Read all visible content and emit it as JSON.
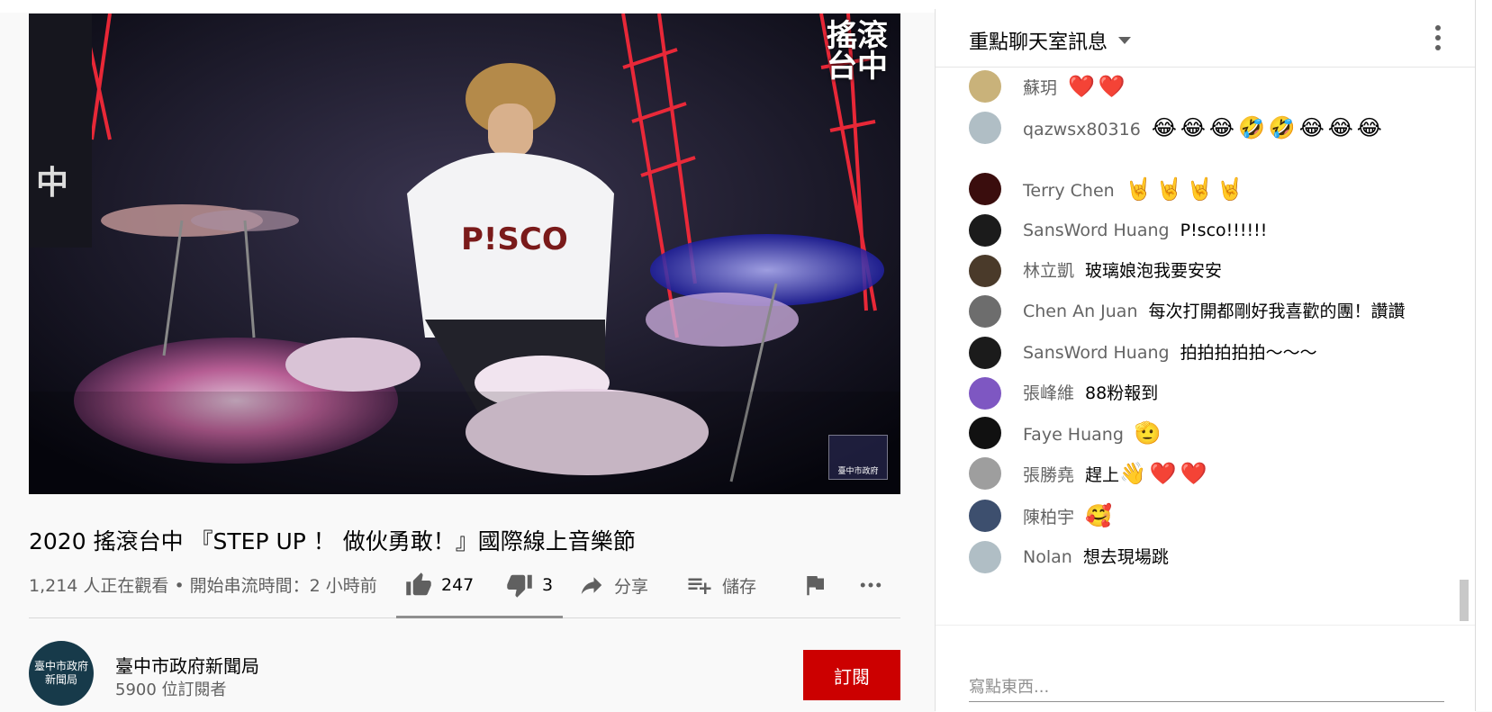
{
  "video": {
    "badge_text": "搖滾\n台中",
    "corner_logo_text": "臺中市政府"
  },
  "title": "2020 搖滾台中 『STEP UP ！ 做伙勇敢！』國際線上音樂節",
  "meta": {
    "views": "1,214 人正在觀看",
    "separator": "•",
    "started": "開始串流時間：2 小時前"
  },
  "actions": {
    "likes": "247",
    "dislikes": "3",
    "share": "分享",
    "save": "儲存"
  },
  "channel": {
    "avatar_text": "臺中市政府\n新聞局",
    "name": "臺中市政府新聞局",
    "subs": "5900 位訂閱者",
    "subscribe": "訂閱"
  },
  "chat": {
    "title": "重點聊天室訊息",
    "input_placeholder": "寫點東西...",
    "messages": [
      {
        "author": "蘇玥",
        "text": "",
        "emoji": "❤️❤️",
        "avatar_color": "#c9b27a"
      },
      {
        "author": "qazwsx80316",
        "text": "",
        "emoji": "😂😂😂🤣🤣😂😂😂",
        "avatar_color": "#b0bec5"
      },
      {
        "author": "Terry Chen",
        "text": "",
        "emoji": "🤘🤘🤘🤘",
        "avatar_color": "#3a0d0d"
      },
      {
        "author": "SansWord Huang",
        "text": "P!sco!!!!!!",
        "emoji": "",
        "avatar_color": "#1b1b1b"
      },
      {
        "author": "林立凱",
        "text": "玻璃娘泡我要安安",
        "emoji": "",
        "avatar_color": "#4a3a2a"
      },
      {
        "author": "Chen An Juan",
        "text": "每次打開都剛好我喜歡的團！讚讚",
        "emoji": "",
        "avatar_color": "#6d6d6d"
      },
      {
        "author": "SansWord Huang",
        "text": "拍拍拍拍拍～～～",
        "emoji": "",
        "avatar_color": "#1b1b1b"
      },
      {
        "author": "張峰維",
        "text": "88粉報到",
        "emoji": "",
        "avatar_color": "#7e57c2"
      },
      {
        "author": "Faye Huang",
        "text": "",
        "emoji": "🫡",
        "avatar_color": "#111111"
      },
      {
        "author": "張勝堯",
        "text": "趕上",
        "emoji": "👋❤️❤️",
        "avatar_color": "#9e9e9e"
      },
      {
        "author": "陳柏宇",
        "text": "",
        "emoji": "🥰",
        "avatar_color": "#3d4f6e"
      },
      {
        "author": "Nolan",
        "text": "想去現場跳",
        "emoji": "",
        "avatar_color": "#b0bec5"
      }
    ]
  }
}
